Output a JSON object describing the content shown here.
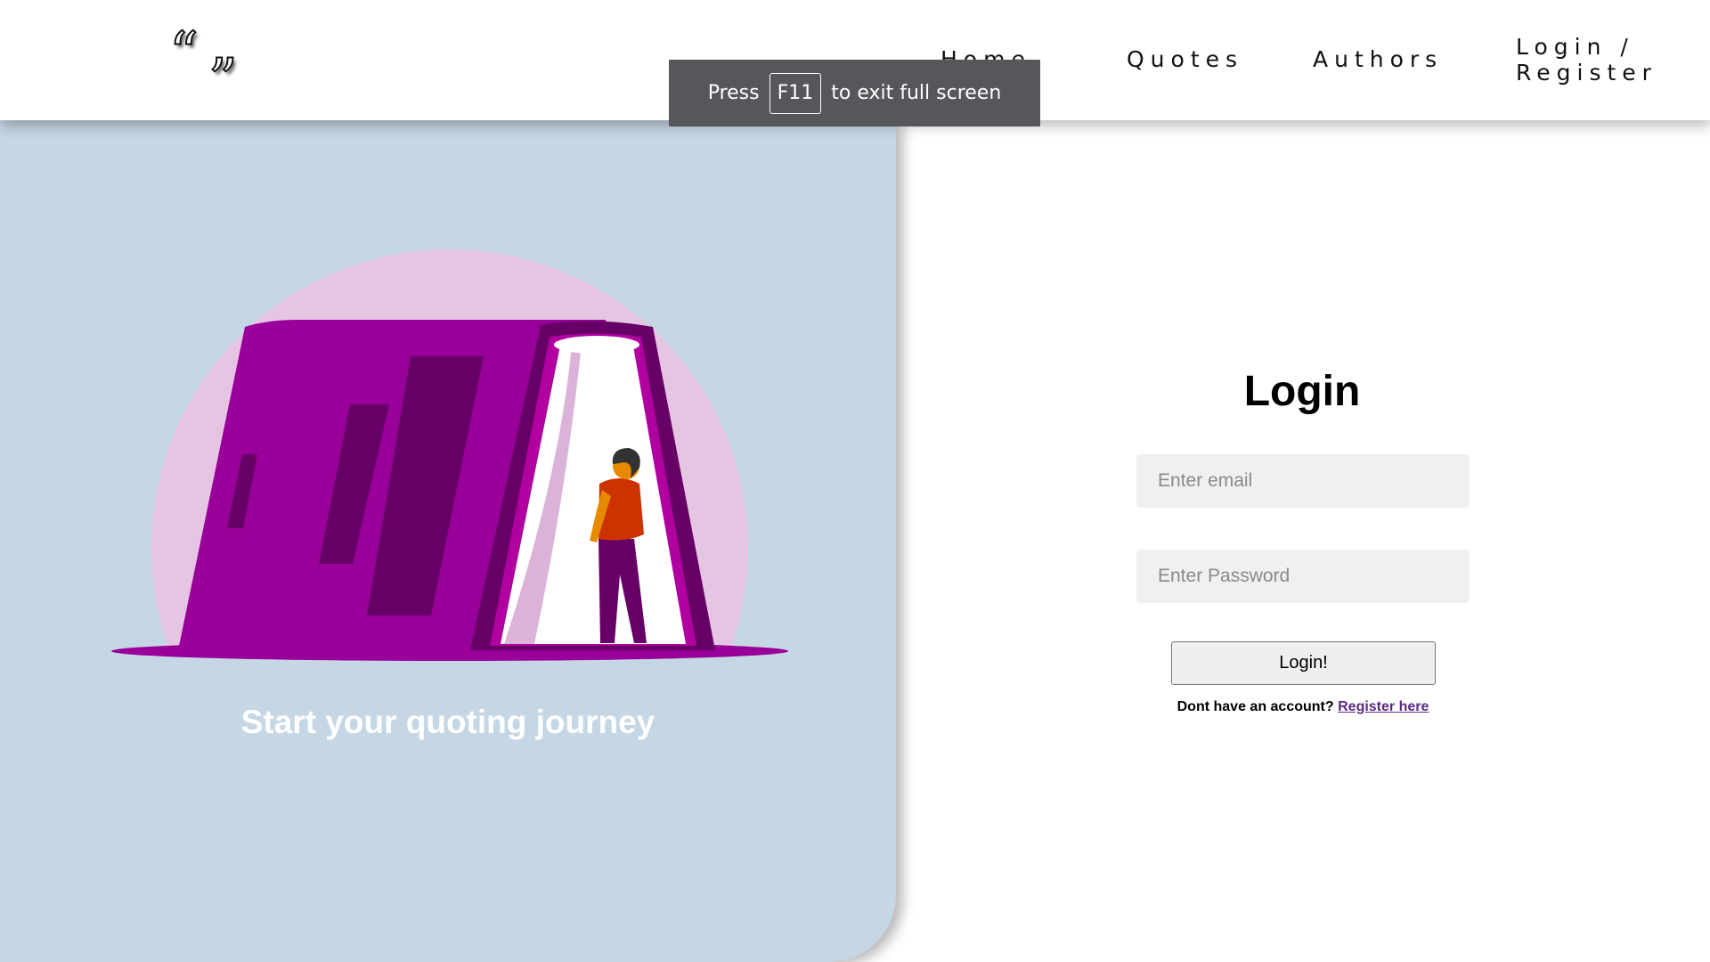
{
  "nav": {
    "logo": {
      "open_quote": "“",
      "close_quote": "”"
    },
    "links": [
      "Home",
      "Quotes",
      "Authors",
      "Login /",
      "Register"
    ]
  },
  "fullscreen_toast": {
    "press": "Press",
    "key": "F11",
    "message": "to exit full screen"
  },
  "hero": {
    "tagline": "Start your quoting journey",
    "colors": {
      "panel": "#c5d6e4",
      "circle": "#e6c5e3",
      "building": "#990099",
      "building_dark": "#660066"
    }
  },
  "login": {
    "title": "Login",
    "email_placeholder": "Enter email",
    "password_placeholder": "Enter Password",
    "button": "Login!",
    "prompt": "Dont have an account?",
    "register_link": "Register here"
  }
}
